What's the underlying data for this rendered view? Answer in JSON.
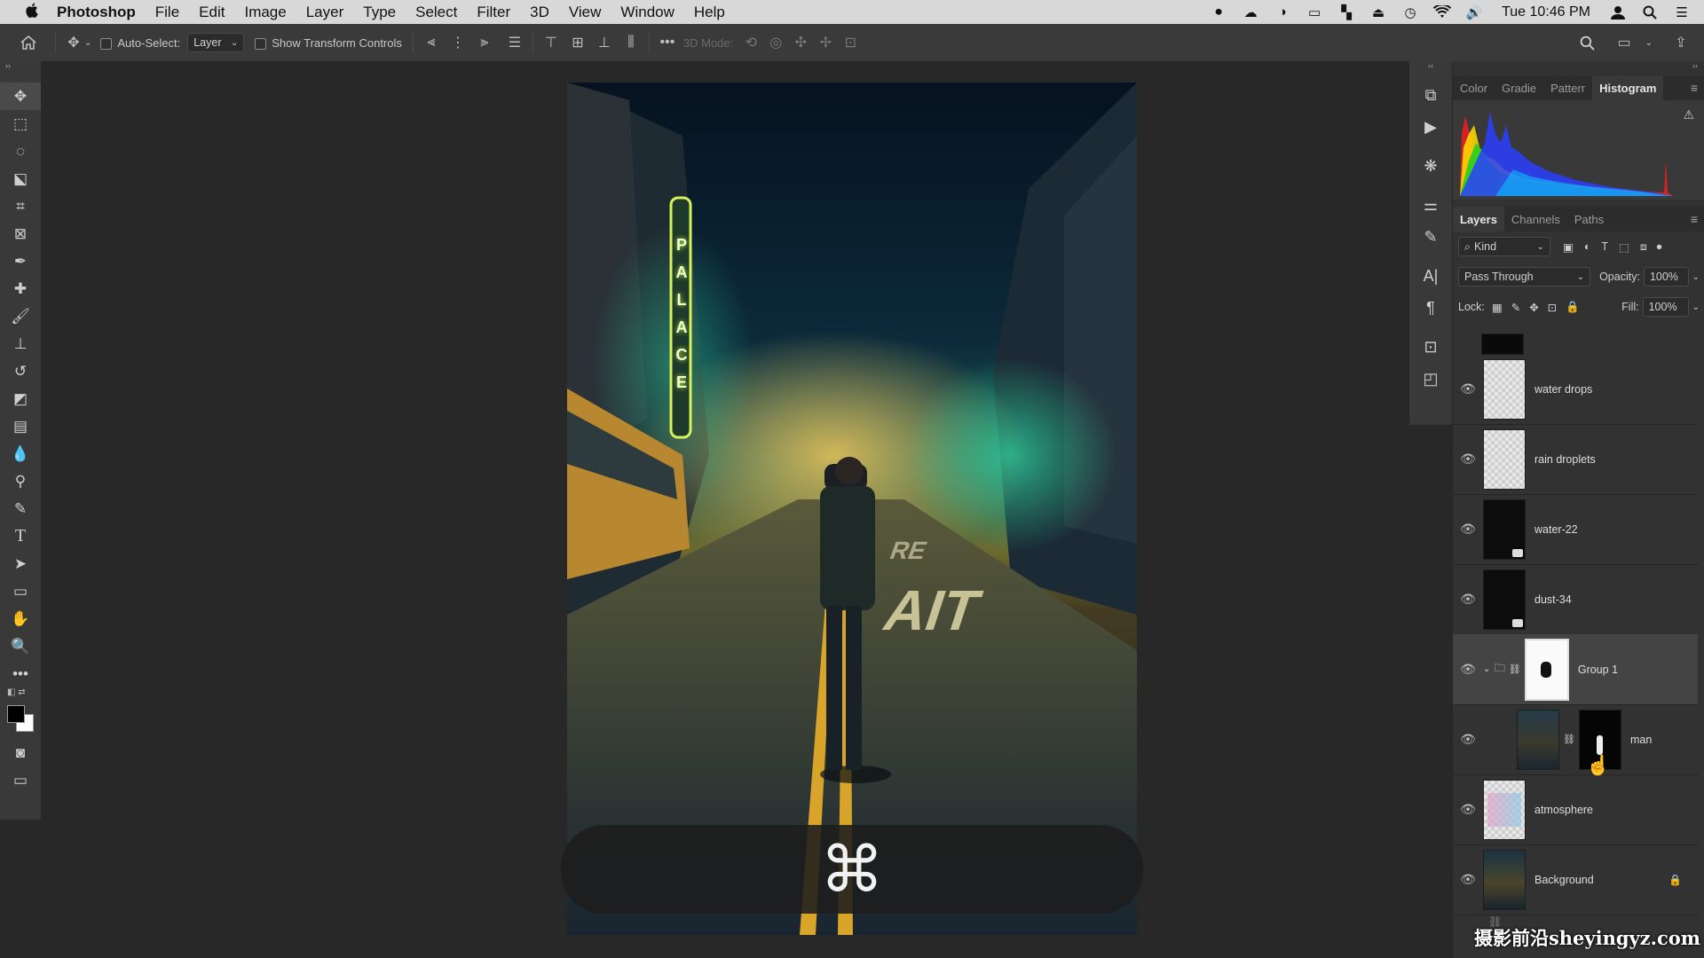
{
  "menubar": {
    "app_name": "Photoshop",
    "items": [
      "File",
      "Edit",
      "Image",
      "Layer",
      "Type",
      "Select",
      "Filter",
      "3D",
      "View",
      "Window",
      "Help"
    ],
    "clock": "Tue 10:46 PM"
  },
  "options": {
    "auto_select_label": "Auto-Select:",
    "auto_select_value": "Layer",
    "show_transform_label": "Show Transform Controls",
    "mode_3d_label": "3D Mode:"
  },
  "panels": {
    "top_tabs": [
      "Color",
      "Gradie",
      "Patterr",
      "Histogram"
    ],
    "active_top_tab": "Histogram",
    "layer_tabs": [
      "Layers",
      "Channels",
      "Paths"
    ],
    "active_layer_tab": "Layers",
    "filter_kind": "Kind",
    "blend_mode": "Pass Through",
    "opacity_label": "Opacity:",
    "opacity_value": "100%",
    "lock_label": "Lock:",
    "fill_label": "Fill:",
    "fill_value": "100%"
  },
  "layers": [
    {
      "name": "water drops"
    },
    {
      "name": "rain droplets"
    },
    {
      "name": "water-22"
    },
    {
      "name": "dust-34"
    },
    {
      "name": "Group 1"
    },
    {
      "name": "man"
    },
    {
      "name": "atmosphere"
    },
    {
      "name": "Background"
    }
  ],
  "photo": {
    "sign_letters": [
      "P",
      "A",
      "L",
      "A",
      "C",
      "E"
    ],
    "road_text_1": "RE",
    "road_text_2": "AIT"
  },
  "hud_symbol": "⌘",
  "watermark": "摄影前沿sheyingyz.com"
}
